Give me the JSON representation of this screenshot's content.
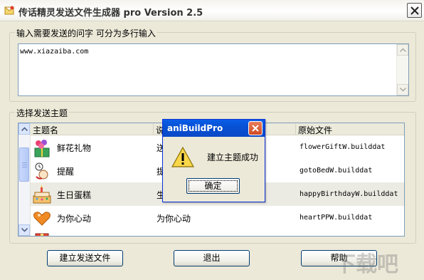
{
  "window": {
    "title": "传话精灵发送文件生成器 pro Version 2.5"
  },
  "message_group": {
    "legend": "输入需要发送的问字 可分为多行输入",
    "value": "www.xiazaiba.com"
  },
  "theme_group": {
    "legend": "选择发送主题",
    "columns": [
      "主题名",
      "说",
      "原始文件"
    ],
    "rows": [
      {
        "name": "鲜花礼物",
        "desc": "送",
        "file": "flowerGiftW.builddat",
        "icon": "flower-gift-icon"
      },
      {
        "name": "提醒",
        "desc": "提",
        "file": "gotoBedW.builddat",
        "icon": "alarm-clock-icon"
      },
      {
        "name": "生日蛋糕",
        "desc": "生",
        "file": "happyBirthdayW.builddat",
        "icon": "birthday-cake-icon"
      },
      {
        "name": "为你心动",
        "desc": "为你心动",
        "file": "heartPPW.builddat",
        "icon": "heart-icon"
      },
      {
        "name": "",
        "desc": "",
        "file": "",
        "icon": "gift-icon"
      }
    ]
  },
  "buttons": {
    "build": "建立发送文件",
    "exit": "退出",
    "help": "帮助"
  },
  "dialog": {
    "title": "aniBuildPro",
    "message": "建立主题成功",
    "ok": "确定",
    "icon": "warning-icon"
  },
  "watermark": {
    "text": "下载吧"
  }
}
